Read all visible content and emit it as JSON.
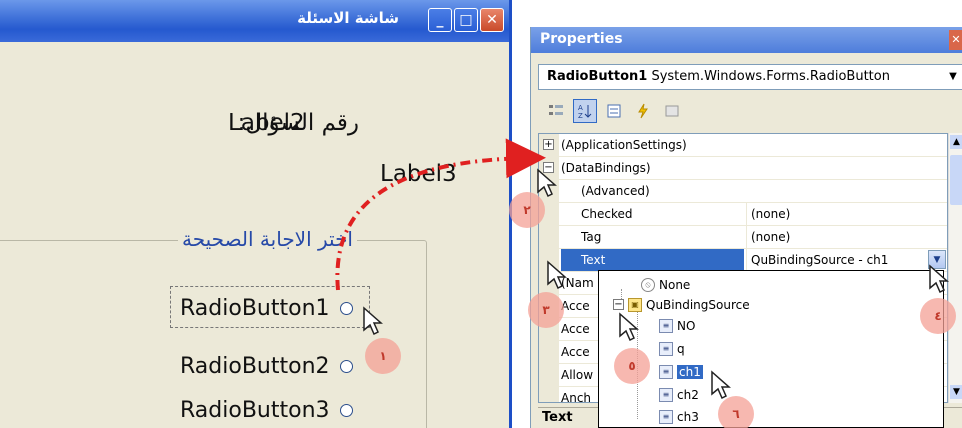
{
  "form": {
    "title": "شاشة الاسئلة",
    "caption_buttons": {
      "minimize": "_",
      "maximize": "□",
      "close": "✕"
    },
    "question_label": "رقم السؤال:",
    "label2": "Label2",
    "label3": "Label3",
    "group_caption": "اختر الاجابة الصحيحة",
    "radio_buttons": [
      "RadioButton1",
      "RadioButton2",
      "RadioButton3"
    ]
  },
  "properties": {
    "title": "Properties",
    "close": "✕",
    "object_name": "RadioButton1",
    "object_type": "System.Windows.Forms.RadioButton",
    "toolbar_icons": [
      "categorized-icon",
      "alphabetical-icon",
      "properties-icon",
      "events-icon",
      "property-pages-icon"
    ],
    "rows": [
      {
        "name": "(ApplicationSettings)",
        "value": "",
        "expander": "+"
      },
      {
        "name": "(DataBindings)",
        "value": "",
        "expander": "−"
      },
      {
        "name": "(Advanced)",
        "value": ""
      },
      {
        "name": "Checked",
        "value": "(none)"
      },
      {
        "name": "Tag",
        "value": "(none)"
      },
      {
        "name": "Text",
        "value": "QuBindingSource - ch1"
      },
      {
        "name": "(Nam",
        "value": ""
      },
      {
        "name": "Acce",
        "value": ""
      },
      {
        "name": "Acce",
        "value": ""
      },
      {
        "name": "Acce",
        "value": ""
      },
      {
        "name": "Allow",
        "value": ""
      },
      {
        "name": "Anch",
        "value": ""
      }
    ],
    "description_title": "Text",
    "dropdown": {
      "none": "None",
      "source": "QuBindingSource",
      "fields": [
        "NO",
        "q",
        "ch1",
        "ch2",
        "ch3"
      ],
      "selected": "ch1"
    }
  },
  "step_badges": [
    "١",
    "٢",
    "٣",
    "٤",
    "٥",
    "٦"
  ],
  "colors": {
    "title_blue": "#2559cf",
    "selection": "#316ac5",
    "arrow_red": "#e02020",
    "badge": "#f4a096"
  }
}
